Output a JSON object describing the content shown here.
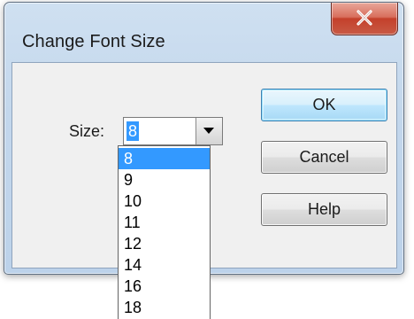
{
  "dialog": {
    "title": "Change Font Size",
    "close_icon": "close-x-icon"
  },
  "form": {
    "size_label": "Size:",
    "combo_value": "8",
    "combo_arrow_icon": "dropdown-arrow-icon"
  },
  "buttons": {
    "ok": "OK",
    "cancel": "Cancel",
    "help": "Help"
  },
  "dropdown": {
    "options": [
      "8",
      "9",
      "10",
      "11",
      "12",
      "14",
      "16",
      "18"
    ],
    "selected": "8"
  },
  "colors": {
    "selection": "#3399ff",
    "close_button": "#c4402b",
    "default_button_border": "#3c7fb1"
  }
}
